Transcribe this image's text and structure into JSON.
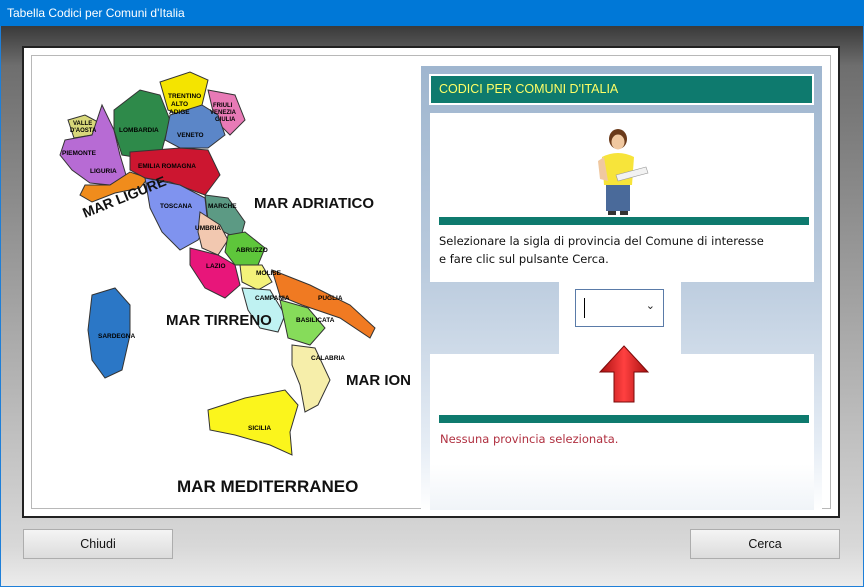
{
  "window": {
    "title": "Tabella Codici per Comuni d'Italia"
  },
  "map": {
    "regions": [
      {
        "name": "VALLE D'AOSTA",
        "color": "#d8d87a"
      },
      {
        "name": "PIEMONTE",
        "color": "#b76bd4"
      },
      {
        "name": "LIGURIA",
        "color": "#f08c1c"
      },
      {
        "name": "LOMBARDIA",
        "color": "#2e8a4a"
      },
      {
        "name": "TRENTINO ALTO ADIGE",
        "color": "#f4e400"
      },
      {
        "name": "FRIULI VENEZIA GIULIA",
        "color": "#e87ab6"
      },
      {
        "name": "VENETO",
        "color": "#5b86c8"
      },
      {
        "name": "EMILIA ROMAGNA",
        "color": "#cc1630"
      },
      {
        "name": "TOSCANA",
        "color": "#7f93ef"
      },
      {
        "name": "MARCHE",
        "color": "#5c9a84"
      },
      {
        "name": "UMBRIA",
        "color": "#f2c8b0"
      },
      {
        "name": "ABRUZZO",
        "color": "#5ec63b"
      },
      {
        "name": "LAZIO",
        "color": "#e8167a"
      },
      {
        "name": "MOLISE",
        "color": "#f4f27a"
      },
      {
        "name": "CAMPANIA",
        "color": "#bff2f2"
      },
      {
        "name": "PUGLIA",
        "color": "#f07a22"
      },
      {
        "name": "BASILICATA",
        "color": "#86dc5a"
      },
      {
        "name": "CALABRIA",
        "color": "#f6eeaa"
      },
      {
        "name": "SICILIA",
        "color": "#fbf51c"
      },
      {
        "name": "SARDEGNA",
        "color": "#2b77c6"
      }
    ],
    "seas": {
      "ligure": "MAR LIGURE",
      "adriatico": "MAR ADRIATICO",
      "tirreno": "MAR TIRRENO",
      "ionio": "MAR IONIO",
      "mediterraneo": "MAR MEDITERRANEO"
    }
  },
  "panel": {
    "header": "CODICI PER COMUNI D'ITALIA",
    "instruction_line1": "Selezionare la sigla di provincia del Comune di interesse",
    "instruction_line2": "e fare clic sul pulsante Cerca.",
    "province_select_value": "",
    "status": "Nessuna provincia selezionata."
  },
  "buttons": {
    "close": "Chiudi",
    "search": "Cerca"
  },
  "colors": {
    "accent": "#0e7a6e",
    "header_text": "#ffff66",
    "status_text": "#b03040",
    "arrow": "#d42020"
  }
}
